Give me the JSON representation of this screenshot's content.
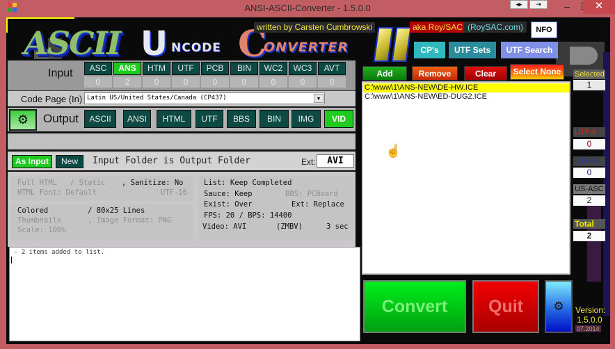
{
  "window": {
    "title": "ANSI-ASCII-Converter - 1.5.0.0",
    "titlebar_buttons": [
      "split-icon",
      "exit-icon"
    ],
    "controls": {
      "minimize": "–",
      "maximize": "☐",
      "close": "✕"
    }
  },
  "header": {
    "logo": {
      "ascii": "ASCII",
      "u": "U",
      "ncode": "NCODE",
      "c": "C",
      "onverter": "ONVERTER",
      "numeral": "II"
    },
    "credit": "written by Carsten Cumbrowski",
    "aka": "aka Roy/SAC",
    "site": "(RoySAC.com)",
    "nfo_label": "NFO",
    "buttons": [
      {
        "label": "CP's",
        "color": "#2fb8c0"
      },
      {
        "label": "UTF Sets",
        "color": "#2a8c9c"
      },
      {
        "label": "UTF Search",
        "color": "#8090e8"
      }
    ]
  },
  "input": {
    "label": "Input",
    "formats": [
      {
        "label": "ASC",
        "count": "0",
        "active": false
      },
      {
        "label": "ANS",
        "count": "2",
        "active": true
      },
      {
        "label": "HTM",
        "count": "0",
        "active": false
      },
      {
        "label": "UTF",
        "count": "0",
        "active": false
      },
      {
        "label": "PCB",
        "count": "0",
        "active": false
      },
      {
        "label": "BIN",
        "count": "0",
        "active": false
      },
      {
        "label": "WC2",
        "count": "0",
        "active": false
      },
      {
        "label": "WC3",
        "count": "0",
        "active": false
      },
      {
        "label": "AVT",
        "count": "0",
        "active": false
      }
    ]
  },
  "codepage": {
    "label": "Code Page (In)",
    "value": "Latin US/United States/Canada (CP437)"
  },
  "output": {
    "label": "Output",
    "formats": [
      {
        "label": "ASCII",
        "active": false
      },
      {
        "label": "ANSI",
        "active": false
      },
      {
        "label": "HTML",
        "active": false
      },
      {
        "label": "UTF",
        "active": false
      },
      {
        "label": "BBS",
        "active": false
      },
      {
        "label": "BIN",
        "active": false
      },
      {
        "label": "IMG",
        "active": false
      },
      {
        "label": "VID",
        "active": true
      }
    ]
  },
  "folder": {
    "as_input_label": "As Input",
    "new_label": "New",
    "text": "Input Folder is Output Folder",
    "ext_label": "Ext:",
    "ext_value": "AVI"
  },
  "options": {
    "html": {
      "line1a": "Full HTML   / Static",
      "line1b": ", Sanitize: No",
      "line2a": "HTML Font: Default",
      "line2b": "UTF-16"
    },
    "image": {
      "line1": "Colored         / 80x25 Lines",
      "line2": "Thumbnails      , Image Format: PNG",
      "line3": "Scale: 100%"
    },
    "general": {
      "list": "List: Keep Completed",
      "sauce": "Sauce: Keep",
      "bbs": "BBS: PCBoard",
      "exist": "Exist: Over",
      "ext": "Ext: Replace",
      "fps": "FPS: 20 / BPS: 14400",
      "video": "Video: AVI",
      "codec": "(ZMBV)",
      "duration": "3 sec"
    }
  },
  "log": {
    "lines": [
      "- 2 items added to list."
    ]
  },
  "list_actions": [
    {
      "label": "Add"
    },
    {
      "label": "Remove"
    },
    {
      "label": "Clear"
    },
    {
      "label": "Select None"
    }
  ],
  "files": [
    {
      "path": "C:\\www\\1\\ANS-NEW\\DE-HW.ICE",
      "selected": true
    },
    {
      "path": "C:\\www\\1\\ANS-NEW\\ED-DUG2.ICE",
      "selected": false
    }
  ],
  "stats": {
    "selected": {
      "label": "Selected",
      "value": "1"
    },
    "utf8": {
      "label": "UTF-8",
      "value": "0"
    },
    "utf16": {
      "label": "UTF-16",
      "value": "0"
    },
    "usasc": {
      "label": "US-ASC",
      "value": "2"
    },
    "total": {
      "label": "Total",
      "value": "2"
    }
  },
  "actions": {
    "convert": "Convert",
    "quit": "Quit",
    "settings_icon": "⚙"
  },
  "version": {
    "label": "Version:",
    "number": "1.5.0.0",
    "date": "07.2014"
  }
}
